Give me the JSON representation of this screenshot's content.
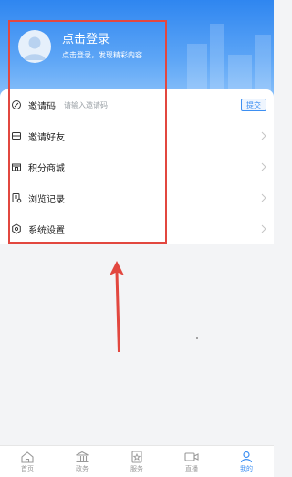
{
  "profile": {
    "title": "点击登录",
    "subtitle": "点击登录，发现精彩内容"
  },
  "menu": {
    "invite_code": {
      "label": "邀请码",
      "placeholder": "请输入邀请码",
      "submit_label": "提交"
    },
    "items": [
      {
        "label": "邀请好友",
        "icon": "invite-friends-icon"
      },
      {
        "label": "积分商城",
        "icon": "points-mall-icon"
      },
      {
        "label": "浏览记录",
        "icon": "history-icon"
      },
      {
        "label": "系统设置",
        "icon": "settings-icon"
      }
    ]
  },
  "tabbar": {
    "tabs": [
      {
        "label": "首页",
        "icon": "home-icon",
        "active": false
      },
      {
        "label": "政务",
        "icon": "government-icon",
        "active": false
      },
      {
        "label": "服务",
        "icon": "service-icon",
        "active": false
      },
      {
        "label": "直播",
        "icon": "live-video-icon",
        "active": false
      },
      {
        "label": "我的",
        "icon": "profile-icon",
        "active": true
      }
    ]
  },
  "colors": {
    "accent": "#3d8ff2",
    "hero_top": "#2f86f0",
    "annotation": "#e2473f",
    "inactive_tab": "#999999"
  }
}
